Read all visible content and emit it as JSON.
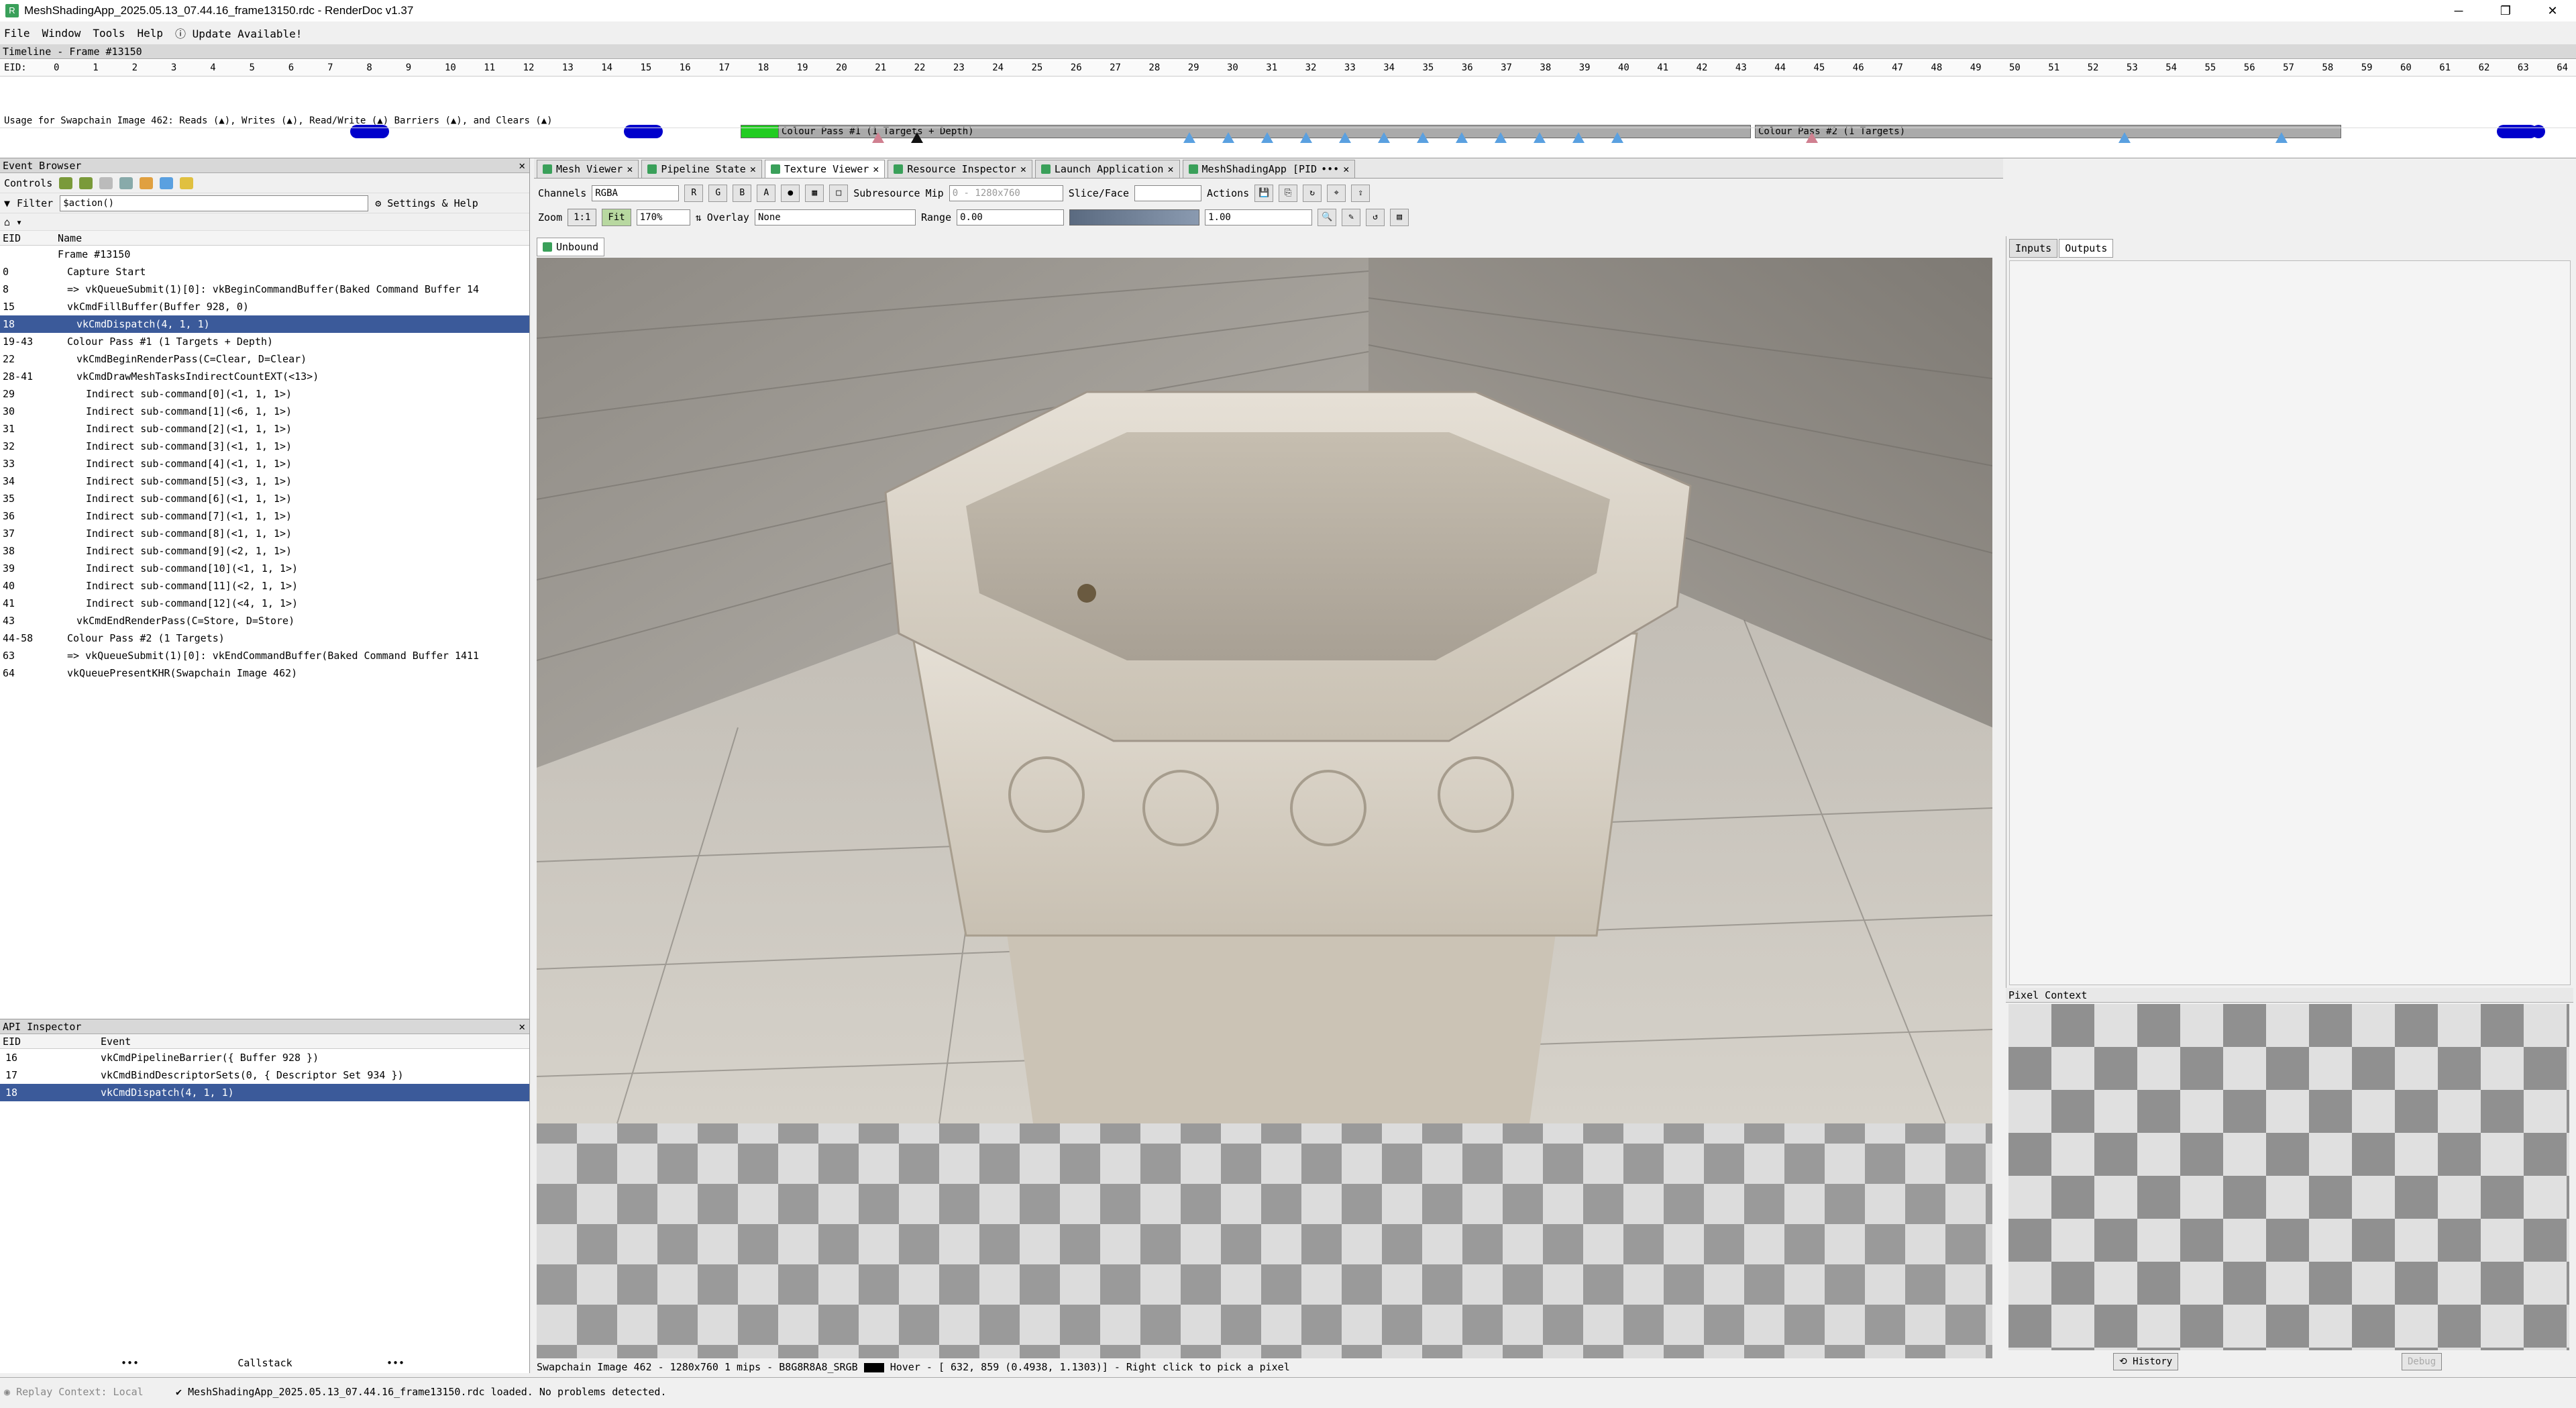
{
  "window": {
    "title": "MeshShadingApp_2025.05.13_07.44.16_frame13150.rdc - RenderDoc v1.37",
    "app_icon": "renderdoc-icon"
  },
  "menu": {
    "items": [
      "File",
      "Window",
      "Tools",
      "Help"
    ],
    "update": "Update Available!"
  },
  "timeline": {
    "title": "Timeline - Frame #13150",
    "eid_label": "EID:",
    "eids": [
      "0",
      "1",
      "2",
      "3",
      "4",
      "5",
      "6",
      "7",
      "8",
      "9",
      "10",
      "11",
      "12",
      "13",
      "14",
      "15",
      "16",
      "17",
      "18",
      "19",
      "20",
      "21",
      "22",
      "23",
      "24",
      "25",
      "26",
      "27",
      "28",
      "29",
      "30",
      "31",
      "32",
      "33",
      "34",
      "35",
      "36",
      "37",
      "38",
      "39",
      "40",
      "41",
      "42",
      "43",
      "44",
      "45",
      "46",
      "47",
      "48",
      "49",
      "50",
      "51",
      "52",
      "53",
      "54",
      "55",
      "56",
      "57",
      "58",
      "59",
      "60",
      "61",
      "62",
      "63",
      "64"
    ],
    "pass1": "Colour Pass #1 (1 Targets + Depth)",
    "pass2": "Colour Pass #2 (1 Targets)",
    "usage": "Usage for Swapchain Image 462: Reads (▲), Writes (▲), Read/Write (▲) Barriers (▲), and Clears (▲)"
  },
  "event_browser": {
    "title": "Event Browser",
    "controls_label": "Controls",
    "filter_label": "Filter",
    "filter_value": "$action()",
    "settings_label": "Settings & Help",
    "col_eid": "EID",
    "col_name": "Name",
    "rows": [
      {
        "eid": "",
        "name": "Frame #13150",
        "indent": 0
      },
      {
        "eid": "0",
        "name": "Capture Start",
        "indent": 1
      },
      {
        "eid": "8",
        "name": "=>  vkQueueSubmit(1)[0]:  vkBeginCommandBuffer(Baked Command Buffer 14",
        "indent": 1
      },
      {
        "eid": "15",
        "name": "vkCmdFillBuffer(Buffer 928, 0)",
        "indent": 1
      },
      {
        "eid": "18",
        "name": "vkCmdDispatch(4, 1, 1)",
        "indent": 2,
        "selected": true
      },
      {
        "eid": "19-43",
        "name": "Colour Pass #1 (1 Targets + Depth)",
        "indent": 1
      },
      {
        "eid": "22",
        "name": "vkCmdBeginRenderPass(C=Clear, D=Clear)",
        "indent": 2
      },
      {
        "eid": "28-41",
        "name": "vkCmdDrawMeshTasksIndirectCountEXT(<13>)",
        "indent": 2
      },
      {
        "eid": "29",
        "name": "Indirect sub-command[0](<1, 1, 1>)",
        "indent": 3
      },
      {
        "eid": "30",
        "name": "Indirect sub-command[1](<6, 1, 1>)",
        "indent": 3
      },
      {
        "eid": "31",
        "name": "Indirect sub-command[2](<1, 1, 1>)",
        "indent": 3
      },
      {
        "eid": "32",
        "name": "Indirect sub-command[3](<1, 1, 1>)",
        "indent": 3
      },
      {
        "eid": "33",
        "name": "Indirect sub-command[4](<1, 1, 1>)",
        "indent": 3
      },
      {
        "eid": "34",
        "name": "Indirect sub-command[5](<3, 1, 1>)",
        "indent": 3
      },
      {
        "eid": "35",
        "name": "Indirect sub-command[6](<1, 1, 1>)",
        "indent": 3
      },
      {
        "eid": "36",
        "name": "Indirect sub-command[7](<1, 1, 1>)",
        "indent": 3
      },
      {
        "eid": "37",
        "name": "Indirect sub-command[8](<1, 1, 1>)",
        "indent": 3
      },
      {
        "eid": "38",
        "name": "Indirect sub-command[9](<2, 1, 1>)",
        "indent": 3
      },
      {
        "eid": "39",
        "name": "Indirect sub-command[10](<1, 1, 1>)",
        "indent": 3
      },
      {
        "eid": "40",
        "name": "Indirect sub-command[11](<2, 1, 1>)",
        "indent": 3
      },
      {
        "eid": "41",
        "name": "Indirect sub-command[12](<4, 1, 1>)",
        "indent": 3
      },
      {
        "eid": "43",
        "name": "vkCmdEndRenderPass(C=Store, D=Store)",
        "indent": 2
      },
      {
        "eid": "44-58",
        "name": "Colour Pass #2 (1 Targets)",
        "indent": 1
      },
      {
        "eid": "63",
        "name": "=>  vkQueueSubmit(1)[0]:  vkEndCommandBuffer(Baked Command Buffer 1411",
        "indent": 1
      },
      {
        "eid": "64",
        "name": "vkQueuePresentKHR(Swapchain Image 462)",
        "indent": 1
      }
    ]
  },
  "api_inspector": {
    "title": "API Inspector",
    "col_eid": "EID",
    "col_event": "Event",
    "rows": [
      {
        "eid": "16",
        "event": "vkCmdPipelineBarrier({  Buffer 928  })"
      },
      {
        "eid": "17",
        "event": "vkCmdBindDescriptorSets(0,  {  Descriptor Set 934  })"
      },
      {
        "eid": "18",
        "event": "vkCmdDispatch(4, 1, 1)",
        "selected": true
      }
    ],
    "callstack": "Callstack"
  },
  "tabs": [
    {
      "label": "Mesh Viewer"
    },
    {
      "label": "Pipeline State"
    },
    {
      "label": "Texture Viewer",
      "active": true
    },
    {
      "label": "Resource Inspector"
    },
    {
      "label": "Launch Application"
    },
    {
      "label": "MeshShadingApp [PID"
    }
  ],
  "texture_viewer": {
    "channels_label": "Channels",
    "channels_value": "RGBA",
    "subresource_label": "Subresource",
    "mip_label": "Mip",
    "mip_value": "0 - 1280x760",
    "slice_label": "Slice/Face",
    "actions_label": "Actions",
    "zoom_label": "Zoom",
    "zoom_11": "1:1",
    "fit_label": "Fit",
    "zoom_value": "170%",
    "overlay_label": "Overlay",
    "overlay_value": "None",
    "range_label": "Range",
    "range_min": "0.00",
    "range_max": "1.00",
    "unbound_tab": "Unbound",
    "status": "Swapchain Image 462 - 1280x760 1 mips - B8G8R8A8_SRGB",
    "hover": "Hover - [ 632,  859 (0.4938, 1.1303)] - Right click to pick a pixel"
  },
  "right_panel": {
    "inputs": "Inputs",
    "outputs": "Outputs",
    "pixel_context": "Pixel Context",
    "history": "History",
    "debug": "Debug"
  },
  "status_bar": {
    "replay": "Replay Context: Local",
    "message": "MeshShadingApp_2025.05.13_07.44.16_frame13150.rdc loaded. No problems detected."
  }
}
